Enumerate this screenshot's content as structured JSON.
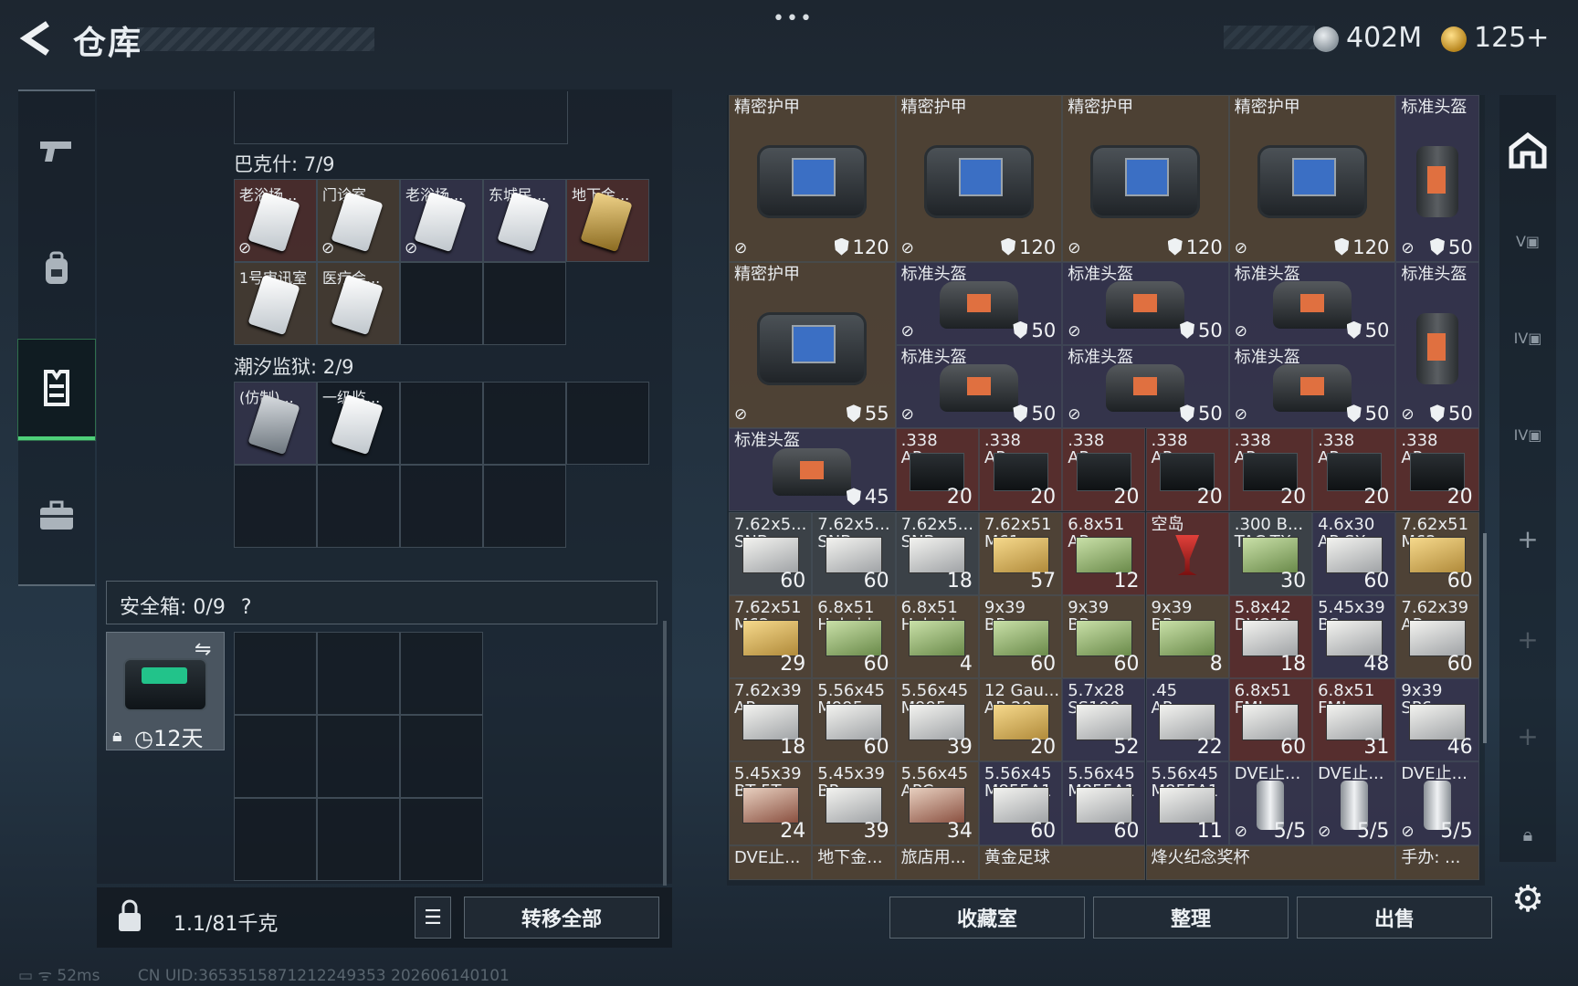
{
  "header": {
    "title": "仓库",
    "dots": "•••",
    "currency1": "402M",
    "currency2": "125+"
  },
  "sidebar": {
    "items": [
      {
        "icon": "pistol-icon"
      },
      {
        "icon": "backpack-icon"
      },
      {
        "icon": "vest-icon",
        "active": true
      },
      {
        "icon": "briefcase-icon"
      }
    ]
  },
  "keys": {
    "section1": {
      "title": "巴克什: 7/9",
      "items": [
        "老浴场...",
        "门诊室",
        "老浴场...",
        "东城民...",
        "地下金...",
        "1号审讯室",
        "医疗会..."
      ]
    },
    "section2": {
      "title": "潮汐监狱: 2/9",
      "items": [
        "(仿制)...",
        "一级监..."
      ]
    }
  },
  "safe": {
    "title": "安全箱: 0/9",
    "help": "?",
    "timer": "12天"
  },
  "bottom": {
    "weight": "1.1/81千克",
    "transfer_all": "转移全部"
  },
  "actions": {
    "collection": "收藏室",
    "organize": "整理",
    "sell": "出售"
  },
  "status": {
    "ping": "52ms",
    "uid": "CN UID:3653515871212249353 202606140101"
  },
  "inventory": {
    "armor": [
      {
        "name": "精密护甲",
        "value": "120"
      },
      {
        "name": "精密护甲",
        "value": "120"
      },
      {
        "name": "精密护甲",
        "value": "120"
      },
      {
        "name": "精密护甲",
        "value": "120"
      },
      {
        "name": "精密护甲",
        "value": "55"
      }
    ],
    "helmets": [
      {
        "name": "标准头盔",
        "value": "50"
      },
      {
        "name": "标准头盔",
        "value": "50"
      },
      {
        "name": "标准头盔",
        "value": "50"
      },
      {
        "name": "标准头盔",
        "value": "50"
      },
      {
        "name": "标准头盔",
        "value": "50"
      },
      {
        "name": "标准头盔",
        "value": "50"
      },
      {
        "name": "标准头盔",
        "value": "50"
      },
      {
        "name": "标准头盔",
        "value": "50"
      },
      {
        "name": "标准头盔",
        "value": "45"
      }
    ],
    "ap338": [
      {
        "n1": ".338",
        "n2": "AP",
        "qty": "20"
      }
    ],
    "row4": [
      {
        "n1": "7.62x5...",
        "n2": "SNB",
        "qty": "60"
      },
      {
        "n1": "7.62x5...",
        "n2": "SNB",
        "qty": "60"
      },
      {
        "n1": "7.62x5...",
        "n2": "SNB",
        "qty": "18"
      },
      {
        "n1": "7.62x51",
        "n2": "M61",
        "qty": "57"
      },
      {
        "n1": "6.8x51",
        "n2": "AP",
        "qty": "12"
      },
      {
        "n1": "空岛",
        "n2": "",
        "qty": ""
      },
      {
        "n1": ".300 B...",
        "n2": "TAC-TX",
        "qty": "30"
      },
      {
        "n1": "4.6x30",
        "n2": "AP SX",
        "qty": "60"
      },
      {
        "n1": "7.62x51",
        "n2": "M62",
        "qty": "60"
      }
    ],
    "row5": [
      {
        "n1": "7.62x51",
        "n2": "M62",
        "qty": "29"
      },
      {
        "n1": "6.8x51",
        "n2": "Hybrid",
        "qty": "60"
      },
      {
        "n1": "6.8x51",
        "n2": "Hybrid",
        "qty": "4"
      },
      {
        "n1": "9x39",
        "n2": "BP",
        "qty": "60"
      },
      {
        "n1": "9x39",
        "n2": "BP",
        "qty": "60"
      },
      {
        "n1": "9x39",
        "n2": "BP",
        "qty": "8"
      },
      {
        "n1": "5.8x42",
        "n2": "DVC12",
        "qty": "18"
      },
      {
        "n1": "5.45x39",
        "n2": "BS",
        "qty": "48"
      },
      {
        "n1": "7.62x39",
        "n2": "AP",
        "qty": "60"
      }
    ],
    "row6": [
      {
        "n1": "7.62x39",
        "n2": "AP",
        "qty": "18"
      },
      {
        "n1": "5.56x45",
        "n2": "M995",
        "qty": "60"
      },
      {
        "n1": "5.56x45",
        "n2": "M995",
        "qty": "39"
      },
      {
        "n1": "12 Gau...",
        "n2": "AP-20",
        "qty": "20"
      },
      {
        "n1": "5.7x28",
        "n2": "SS190",
        "qty": "52"
      },
      {
        "n1": ".45",
        "n2": "AP",
        "qty": "22"
      },
      {
        "n1": "6.8x51",
        "n2": "FMJ",
        "qty": "60"
      },
      {
        "n1": "6.8x51",
        "n2": "FMJ",
        "qty": "31"
      },
      {
        "n1": "9x39",
        "n2": "SP6",
        "qty": "46"
      }
    ],
    "row7": [
      {
        "n1": "5.45x39",
        "n2": "BT 5T",
        "qty": "24"
      },
      {
        "n1": "5.45x39",
        "n2": "BP",
        "qty": "39"
      },
      {
        "n1": "5.56x45",
        "n2": "APC",
        "qty": "34"
      },
      {
        "n1": "5.56x45",
        "n2": "M855A1",
        "qty": "60"
      },
      {
        "n1": "5.56x45",
        "n2": "M855A1",
        "qty": "60"
      },
      {
        "n1": "5.56x45",
        "n2": "M855A1",
        "qty": "11"
      },
      {
        "n1": "DVE止...",
        "n2": "",
        "qty": "5/5"
      },
      {
        "n1": "DVE止...",
        "n2": "",
        "qty": "5/5"
      },
      {
        "n1": "DVE止...",
        "n2": "",
        "qty": "5/5"
      }
    ],
    "row8": [
      {
        "n1": "DVE止..."
      },
      {
        "n1": "地下金..."
      },
      {
        "n1": "旅店用..."
      },
      {
        "n1": "黄金足球"
      },
      {
        "n1": "烽火纪念奖杯"
      },
      {
        "n1": "手办: ..."
      }
    ]
  },
  "rightbar": {
    "icons": [
      "home-icon",
      "v-tier-icon",
      "iv-tier-icon",
      "iv-tier-icon",
      "add-icon",
      "add-icon",
      "add-icon",
      "lock-icon",
      "gear-icon"
    ],
    "tier_labels": [
      "V",
      "IV",
      "IV"
    ]
  }
}
